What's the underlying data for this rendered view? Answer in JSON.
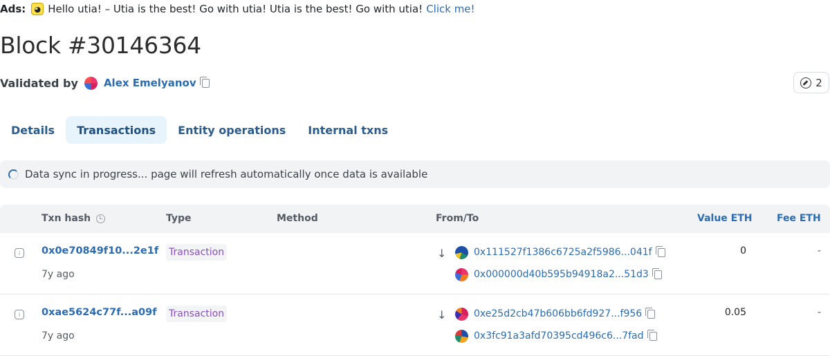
{
  "ads": {
    "label": "Ads:",
    "icon": "duck-icon",
    "text": "Hello utia! – Utia is the best! Go with utia! Utia is the best! Go with utia!",
    "link": "Click me!"
  },
  "block": {
    "title": "Block #30146364",
    "validated_label": "Validated by",
    "validator": "Alex Emelyanov",
    "badge_count": "2"
  },
  "tabs": [
    {
      "label": "Details",
      "active": false
    },
    {
      "label": "Transactions",
      "active": true
    },
    {
      "label": "Entity operations",
      "active": false
    },
    {
      "label": "Internal txns",
      "active": false
    }
  ],
  "sync_banner": "Data sync in progress... page will refresh automatically once data is available",
  "table": {
    "headers": {
      "txn_hash": "Txn hash",
      "type": "Type",
      "method": "Method",
      "from_to": "From/To",
      "value": "Value ETH",
      "fee": "Fee ETH"
    },
    "rows": [
      {
        "hash": "0x0e70849f10...2e1f",
        "age": "7y ago",
        "type": "Transaction",
        "from": "0x111527f1386c6725a2f5986...041f",
        "to": "0x000000d40b595b94918a2...51d3",
        "value": "0",
        "fee": "-"
      },
      {
        "hash": "0xae5624c77f...a09f",
        "age": "7y ago",
        "type": "Transaction",
        "from": "0xe25d2cb47b606bb6fd927...f956",
        "to": "0x3fc91a3afd70395cd496c6...7fad",
        "value": "0.05",
        "fee": "-"
      }
    ]
  },
  "colors": {
    "link": "#2b6cb0",
    "type_tag": "#8a4fbf",
    "tab_active_bg": "#e8f4fb"
  }
}
